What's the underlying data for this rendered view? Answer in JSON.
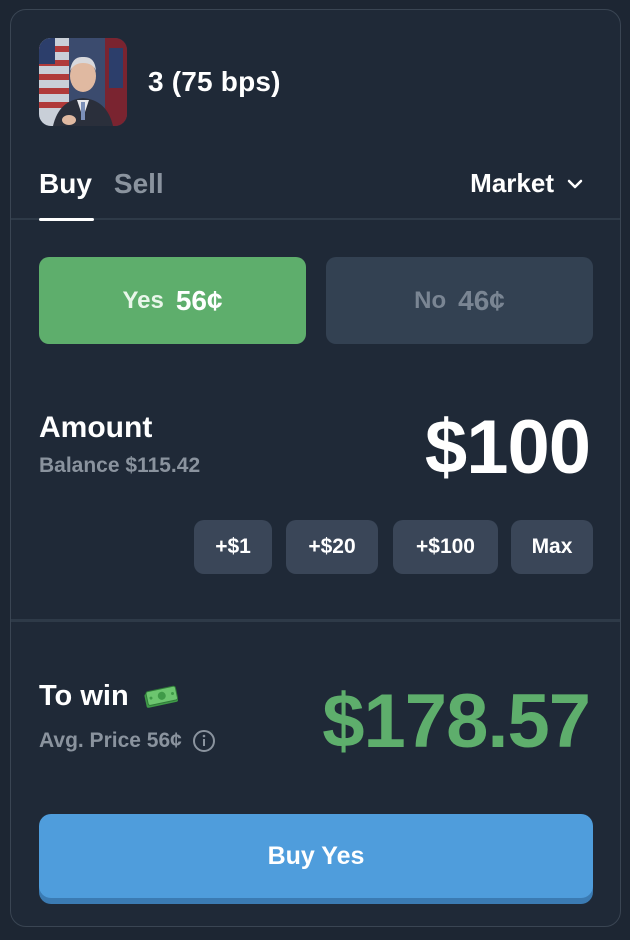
{
  "header": {
    "market_title": "3 (75 bps)",
    "avatar_icon": "speaker-portrait-image"
  },
  "tabs": {
    "buy_label": "Buy",
    "sell_label": "Sell",
    "active": "Buy"
  },
  "order_type": {
    "selected": "Market"
  },
  "outcomes": {
    "yes": {
      "label": "Yes",
      "price": "56¢"
    },
    "no": {
      "label": "No",
      "price": "46¢"
    },
    "selected": "Yes"
  },
  "amount": {
    "label": "Amount",
    "balance": "Balance $115.42",
    "value": "$100"
  },
  "quick_add": [
    "+$1",
    "+$20",
    "+$100",
    "Max"
  ],
  "payout": {
    "to_win_label": "To win",
    "avg_price": "Avg. Price 56¢",
    "value": "$178.57"
  },
  "submit": {
    "label": "Buy Yes"
  },
  "colors": {
    "background": "#1f2937",
    "yes_green": "#5eae6c",
    "no_bg": "#334152",
    "buy_blue": "#4f9ddc",
    "muted_text": "#8a939e"
  }
}
